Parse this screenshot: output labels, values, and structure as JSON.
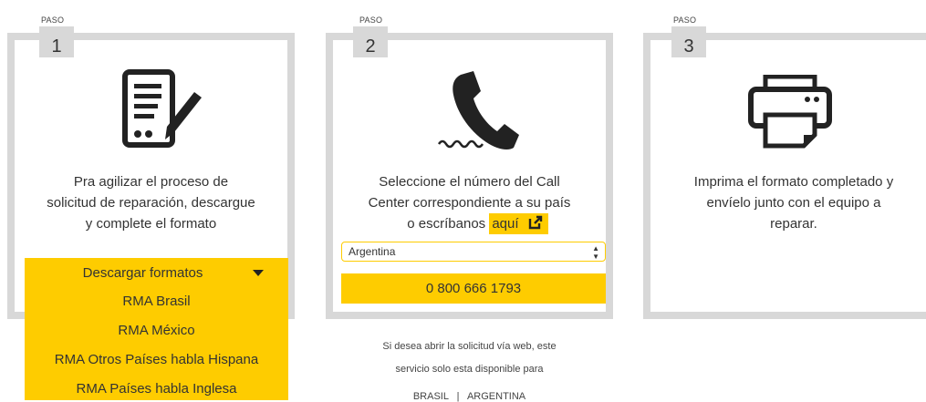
{
  "steps": [
    {
      "tag": "PASO",
      "num": "1",
      "lines": [
        "Pra agilizar el proceso de",
        "solicitud de reparación, descargue",
        "y complete el formato"
      ]
    },
    {
      "tag": "PASO",
      "num": "2",
      "lines": [
        "Seleccione el número del Call",
        "Center correspondiente a su país",
        "o escríbanos"
      ],
      "link_text": "aquí"
    },
    {
      "tag": "PASO",
      "num": "3",
      "lines": [
        "Imprima el formato completado y",
        "envíelo junto con el equipo a",
        "reparar."
      ]
    }
  ],
  "downloads": {
    "toggle_label": "Descargar formatos",
    "items": [
      "RMA Brasil",
      "RMA México",
      "RMA Otros Países habla Hispana",
      "RMA Países habla Inglesa"
    ]
  },
  "country_select": {
    "value": "Argentina"
  },
  "phone_number": "0 800 666 1793",
  "web_note": {
    "line1": "Si desea abrir la solicitud vía web, este",
    "line2": "servicio solo esta disponible para",
    "links": [
      "BRASIL",
      "|",
      "ARGENTINA"
    ]
  },
  "icons": {
    "step1": "document-edit-icon",
    "step2": "phone-icon",
    "step3": "printer-icon",
    "external": "external-link-icon",
    "dropdown": "caret-down-icon",
    "select_arrows": "select-arrows-icon"
  },
  "colors": {
    "accent": "#fecc00",
    "border": "#d8d8d8",
    "text": "#333333"
  }
}
